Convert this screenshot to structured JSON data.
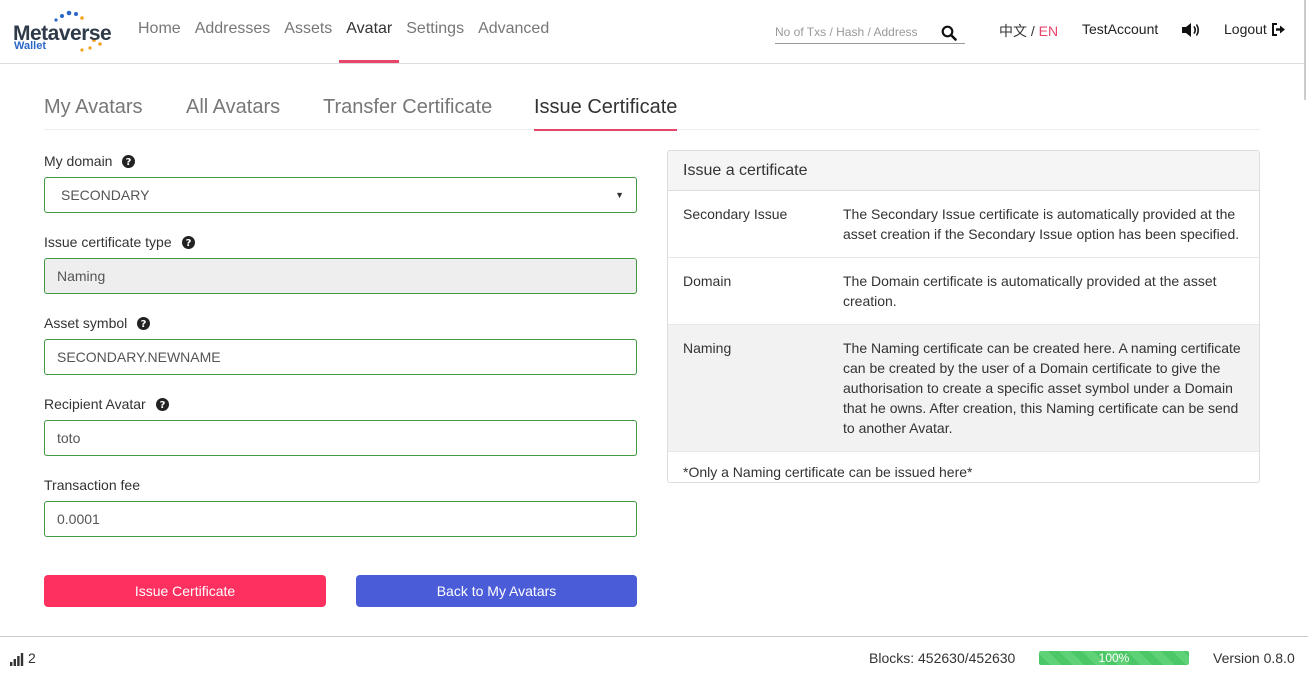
{
  "brand": {
    "name": "Metaverse",
    "sub": "Wallet"
  },
  "nav": [
    {
      "label": "Home"
    },
    {
      "label": "Addresses"
    },
    {
      "label": "Assets"
    },
    {
      "label": "Avatar",
      "active": true
    },
    {
      "label": "Settings"
    },
    {
      "label": "Advanced"
    }
  ],
  "search": {
    "placeholder": "No of Txs / Hash / Address",
    "value": ""
  },
  "lang": {
    "zh": "中文",
    "sep": " / ",
    "en": "EN"
  },
  "account": {
    "name": "TestAccount",
    "logout": "Logout"
  },
  "tabs": [
    {
      "label": "My Avatars"
    },
    {
      "label": "All Avatars"
    },
    {
      "label": "Transfer Certificate"
    },
    {
      "label": "Issue Certificate",
      "active": true
    }
  ],
  "form": {
    "domain": {
      "label": "My domain",
      "value": "SECONDARY"
    },
    "cert_type": {
      "label": "Issue certificate type",
      "value": "Naming"
    },
    "symbol": {
      "label": "Asset symbol",
      "value": "SECONDARY.NEWNAME"
    },
    "recipient": {
      "label": "Recipient Avatar",
      "value": "toto"
    },
    "fee": {
      "label": "Transaction fee",
      "value": "0.0001"
    },
    "issue_button": "Issue Certificate",
    "back_button": "Back to My Avatars"
  },
  "panel": {
    "title": "Issue a certificate",
    "rows": [
      {
        "key": "Secondary Issue",
        "value": "The Secondary Issue certificate is automatically provided at the asset creation if the Secondary Issue option has been specified."
      },
      {
        "key": "Domain",
        "value": "The Domain certificate is automatically provided at the asset creation."
      },
      {
        "key": "Naming",
        "value": "The Naming certificate can be created here. A naming certificate can be created by the user of a Domain certificate to give the authorisation to create a specific asset symbol under a Domain that he owns. After creation, this Naming certificate can be send to another Avatar."
      }
    ],
    "note": "*Only a Naming certificate can be issued here*"
  },
  "footer": {
    "peers": "2",
    "blocks": "Blocks: 452630/452630",
    "sync_progress_percent": 100,
    "sync_label": "100%",
    "version": "Version 0.8.0"
  },
  "colors": {
    "accent": "#e8456b",
    "issue_button": "#fd3060",
    "back_button": "#4b5cd8",
    "input_border": "#3f9a3f",
    "progress": "#4cc765",
    "logo_blue": "#2a68c8"
  },
  "icons": {
    "search": "search-icon",
    "help": "question-circle-icon",
    "sound": "volume-icon",
    "logout": "sign-out-icon",
    "signal": "signal-icon"
  }
}
